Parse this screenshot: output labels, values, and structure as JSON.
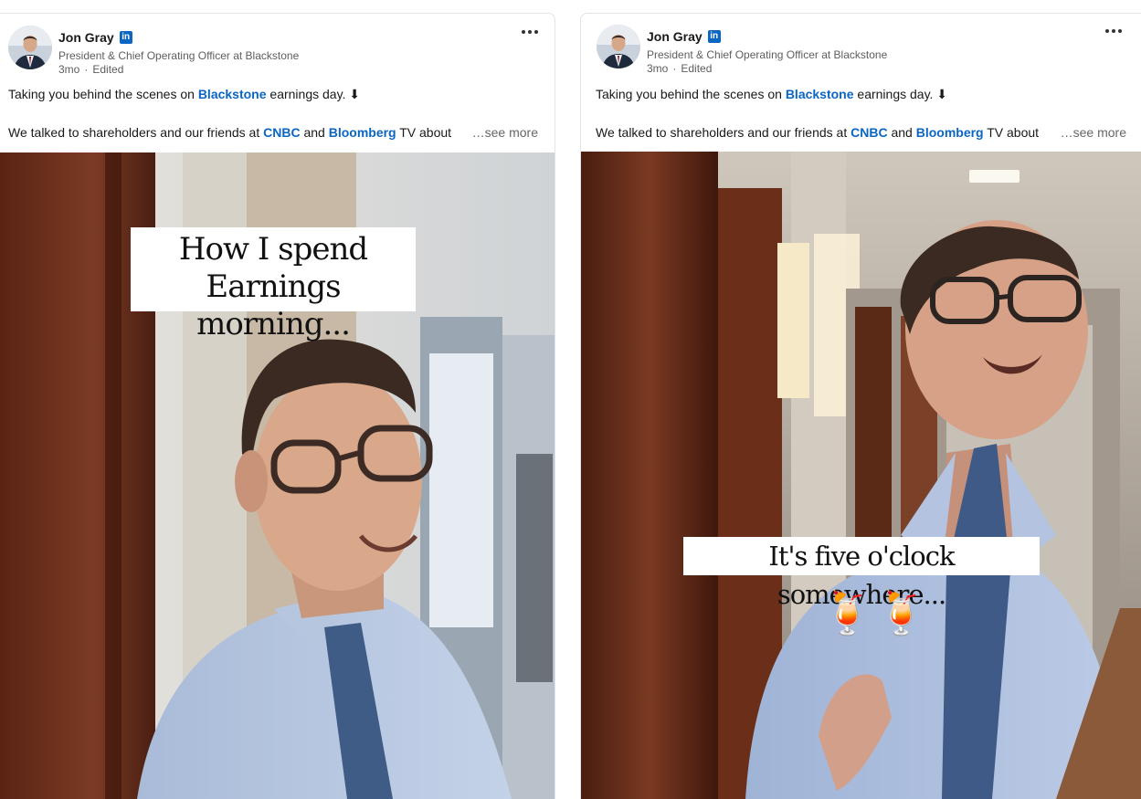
{
  "posts": [
    {
      "author": {
        "name": "Jon Gray",
        "headline": "President & Chief Operating Officer at Blackstone",
        "badge": "in"
      },
      "meta": {
        "age": "3mo",
        "separator": "·",
        "edited": "Edited"
      },
      "text": {
        "line1_before": "Taking you behind the scenes on ",
        "line1_link": "Blackstone",
        "line1_after": " earnings day. ⬇",
        "line2_before": "We talked to shareholders and our friends at ",
        "line2_link1": "CNBC",
        "line2_mid": " and ",
        "line2_link2": "Bloomberg",
        "line2_after": " TV about",
        "see_more": "…see more"
      },
      "video_caption_line1": "How I spend",
      "video_caption_line2": "Earnings morning..."
    },
    {
      "author": {
        "name": "Jon Gray",
        "headline": "President & Chief Operating Officer at Blackstone",
        "badge": "in"
      },
      "meta": {
        "age": "3mo",
        "separator": "·",
        "edited": "Edited"
      },
      "text": {
        "line1_before": "Taking you behind the scenes on ",
        "line1_link": "Blackstone",
        "line1_after": " earnings day. ⬇",
        "line2_before": "We talked to shareholders and our friends at ",
        "line2_link1": "CNBC",
        "line2_mid": " and ",
        "line2_link2": "Bloomberg",
        "line2_after": " TV about",
        "see_more": "…see more"
      },
      "video_caption": "It's five o'clock somewhere...",
      "emoji": "🍹"
    }
  ],
  "icons": {
    "more": "more-horizontal-icon",
    "linkedin_badge": "linkedin-icon"
  },
  "colors": {
    "link": "#0a66c2",
    "muted": "#5e5e5e",
    "badge": "#0a66c2"
  }
}
